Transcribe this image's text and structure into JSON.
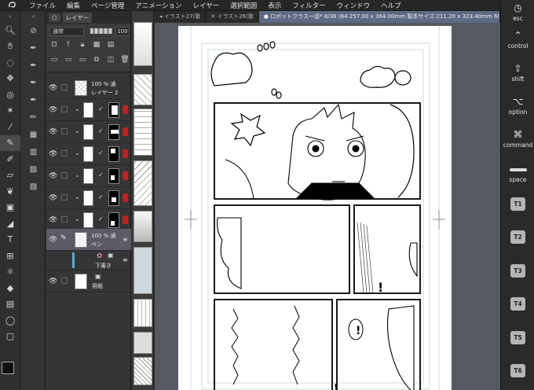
{
  "menubar": {
    "items": [
      "ファイル",
      "編集",
      "ページ管理",
      "アニメーション",
      "レイヤー",
      "選択範囲",
      "表示",
      "フィルター",
      "ウィンドウ",
      "ヘルプ"
    ]
  },
  "layer_panel": {
    "tab_label": "レイヤー",
    "blend_mode": "通常",
    "opacity": "100",
    "layers": [
      {
        "opacity_text": "100 % 通",
        "name": "レイヤー 2"
      },
      {
        "opacity_text": "100 % 通",
        "name": "ペン"
      },
      {
        "name": "下書き"
      },
      {
        "name": "用紙"
      }
    ]
  },
  "document_tabs": {
    "tab1": "イラスト27(歌",
    "tab2": "イラスト26(歌",
    "active": "ロボットクラス一話* 8/36 (B4 257.00 x 364.00mm 製本サイズ:211.20 x 323.40mm 600dpi"
  },
  "shortcut_bar": {
    "esc": "esc",
    "control": "control",
    "shift": "shift",
    "option": "option",
    "command": "command",
    "space": "space",
    "t_keys": [
      "T1",
      "T2",
      "T3",
      "T4",
      "T5",
      "T6"
    ]
  },
  "canvas": {
    "exclamations": [
      "!",
      "!",
      "!"
    ]
  },
  "colors": {
    "accent_tab": "#5d6a85",
    "selected_layer": "#5b5b66",
    "mask_red": "#b22222"
  }
}
